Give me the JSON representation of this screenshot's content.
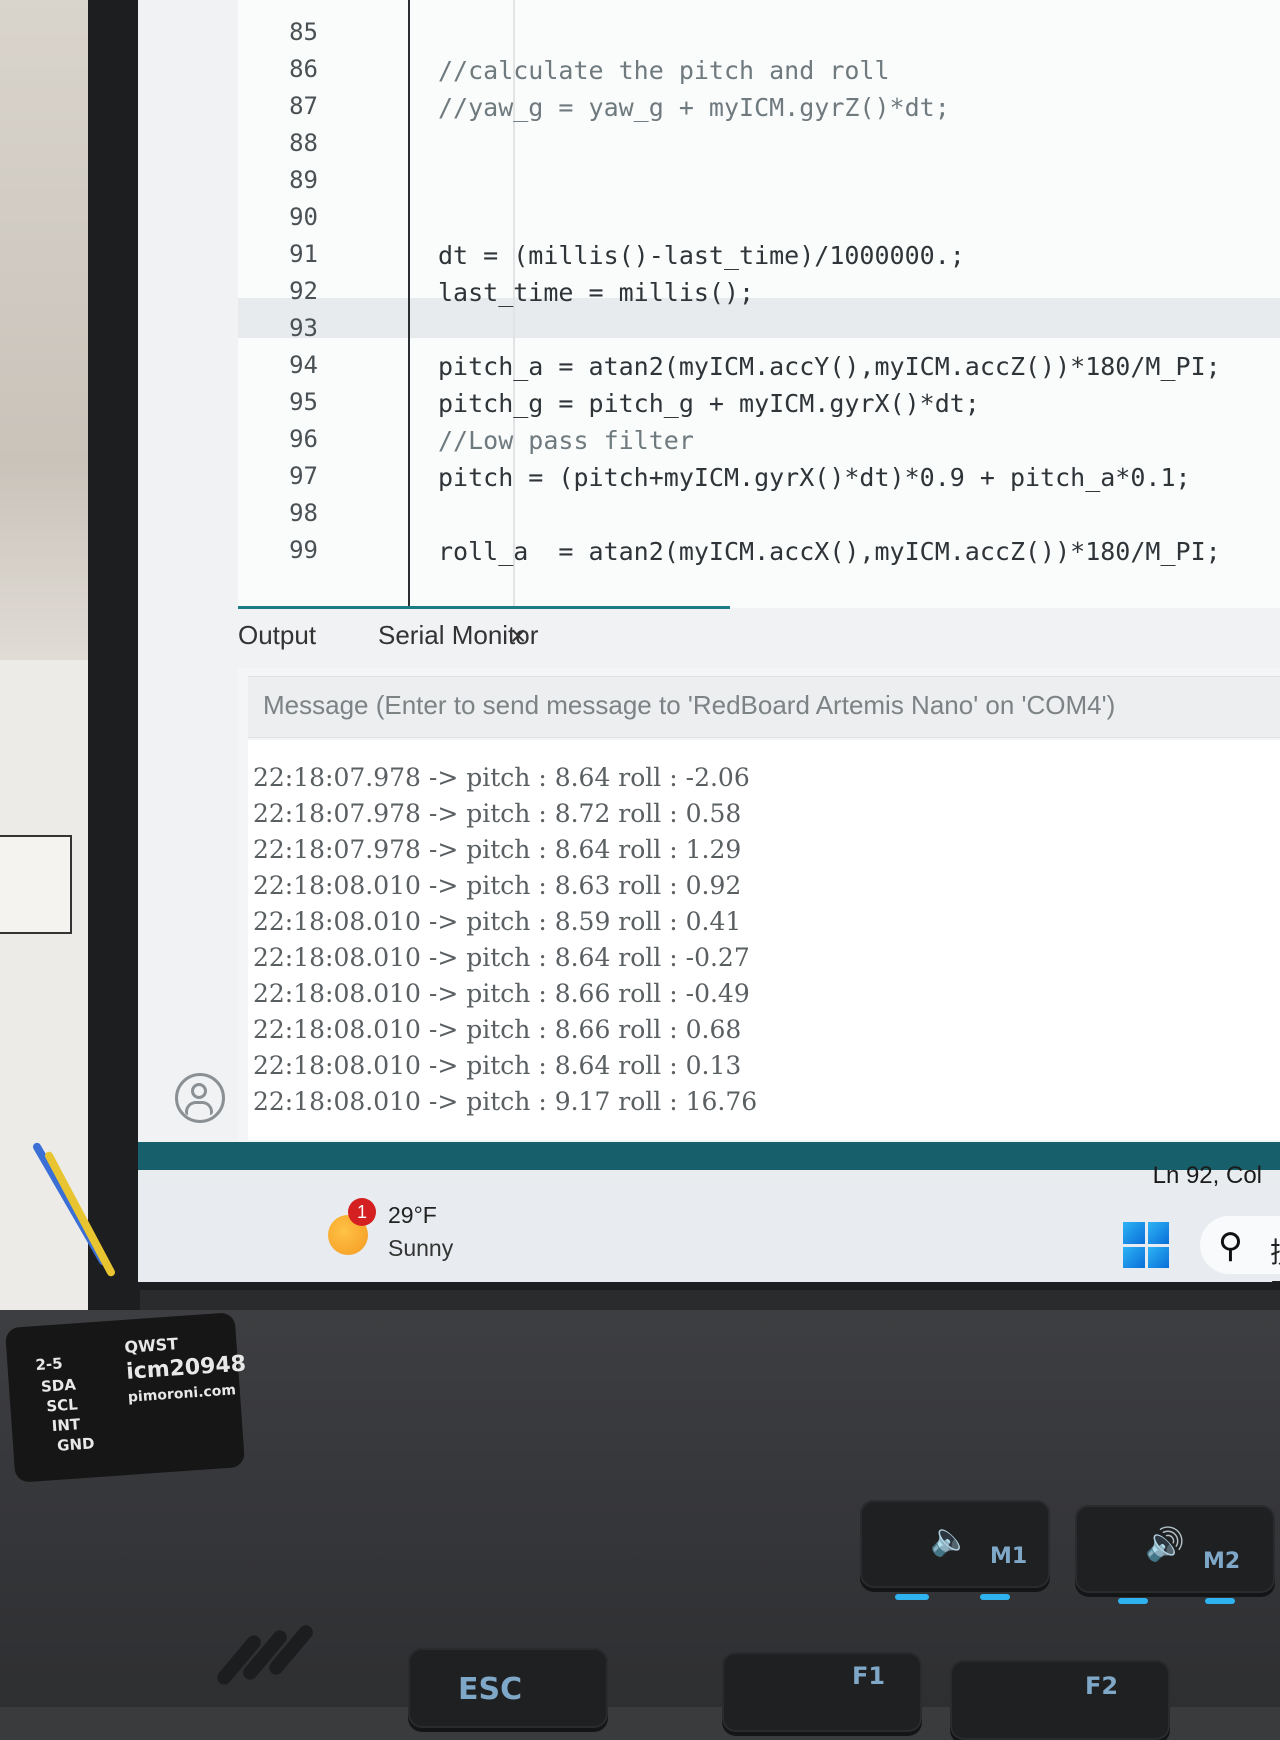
{
  "editor": {
    "line_numbers": [
      "85",
      "86",
      "87",
      "88",
      "89",
      "90",
      "91",
      "92",
      "93",
      "94",
      "95",
      "96",
      "97",
      "98",
      "99"
    ],
    "code_lines": [
      {
        "text": "//calculate the pitch and roll",
        "kind": "comment"
      },
      {
        "text": "//yaw_g = yaw_g + myICM.gyrZ()*dt;",
        "kind": "comment"
      },
      {
        "text": "dt = (millis()-last_time)/1000000.;",
        "kind": "code"
      },
      {
        "text": "last_time = millis();",
        "kind": "code"
      },
      {
        "text": "pitch_a = atan2(myICM.accY(),myICM.accZ())*180/M_PI;",
        "kind": "code"
      },
      {
        "text": "pitch_g = pitch_g + myICM.gyrX()*dt;",
        "kind": "code"
      },
      {
        "text": "//Low pass filter",
        "kind": "comment"
      },
      {
        "text": "pitch = (pitch+myICM.gyrX()*dt)*0.9 + pitch_a*0.1;",
        "kind": "code"
      },
      {
        "text": "roll_a  = atan2(myICM.accX(),myICM.accZ())*180/M_PI;",
        "kind": "code"
      }
    ],
    "current_line": "92"
  },
  "panel": {
    "tab_output": "Output",
    "tab_serial": "Serial Monitor",
    "close_glyph": "×",
    "message_placeholder": "Message (Enter to send message to 'RedBoard Artemis Nano' on 'COM4')",
    "serial_lines": [
      "22:18:07.978 -> pitch : 8.64 roll : -2.06",
      "22:18:07.978 -> pitch : 8.72 roll : 0.58",
      "22:18:07.978 -> pitch : 8.64 roll : 1.29",
      "22:18:08.010 -> pitch : 8.63 roll : 0.92",
      "22:18:08.010 -> pitch : 8.59 roll : 0.41",
      "22:18:08.010 -> pitch : 8.64 roll : -0.27",
      "22:18:08.010 -> pitch : 8.66 roll : -0.49",
      "22:18:08.010 -> pitch : 8.66 roll : 0.68",
      "22:18:08.010 -> pitch : 8.64 roll : 0.13",
      "22:18:08.010 -> pitch : 9.17 roll : 16.76"
    ]
  },
  "status": {
    "position": "Ln 92, Col"
  },
  "taskbar": {
    "weather_badge": "1",
    "weather_temp": "29°F",
    "weather_desc": "Sunny",
    "search_label": "搜索"
  },
  "board": {
    "pins": [
      "2-5",
      "SDA",
      "SCL",
      "INT",
      "GND"
    ],
    "brand_top": "QWST",
    "chip": "icm20948",
    "site": "pimoroni.com"
  },
  "keys": {
    "esc": "ESC",
    "f1": "F1",
    "f2": "F2",
    "m1": "M1",
    "m2": "M2"
  },
  "colors": {
    "status_bar": "#17606b",
    "function_name": "#d35400",
    "comment": "#6f7a7f",
    "key_glow": "#2fb3f0"
  }
}
